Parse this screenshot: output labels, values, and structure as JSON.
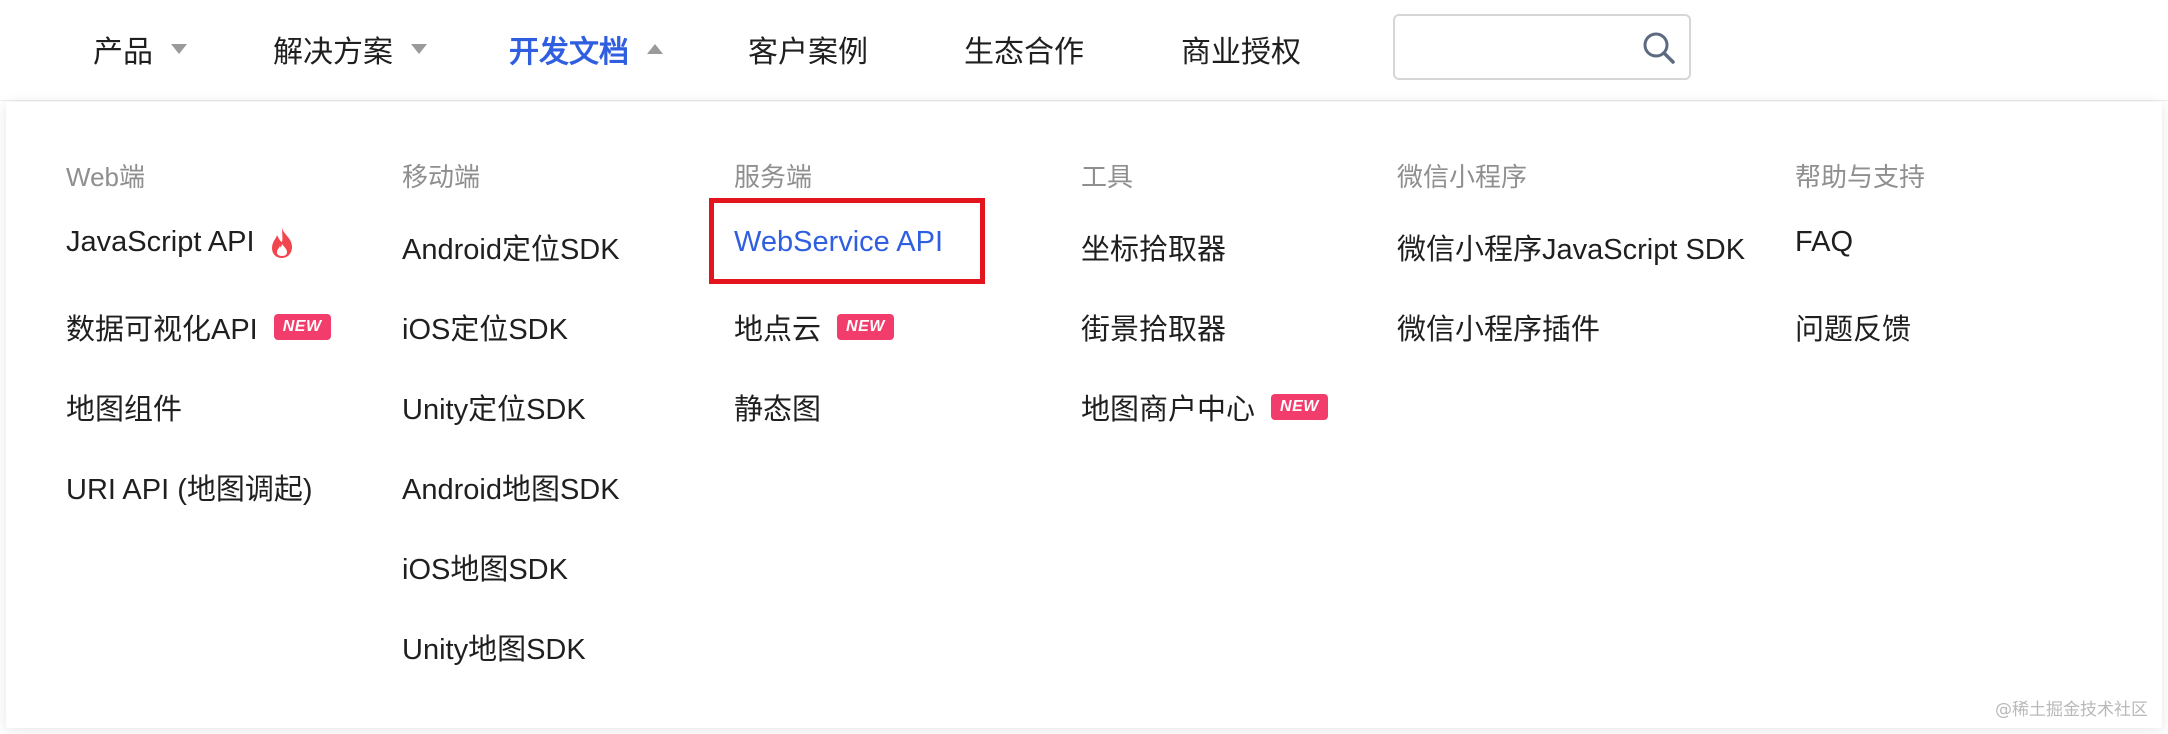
{
  "nav": {
    "items": [
      {
        "label": "产品"
      },
      {
        "label": "解决方案"
      },
      {
        "label": "开发文档"
      },
      {
        "label": "客户案例"
      },
      {
        "label": "生态合作"
      },
      {
        "label": "商业授权"
      }
    ],
    "search": {
      "placeholder": "",
      "value": ""
    }
  },
  "dropdown": {
    "badge_label": "NEW",
    "columns": [
      {
        "header": "Web端",
        "links": [
          {
            "label": "JavaScript API"
          },
          {
            "label": "数据可视化API"
          },
          {
            "label": "地图组件"
          },
          {
            "label": "URI API (地图调起)"
          }
        ]
      },
      {
        "header": "移动端",
        "links": [
          {
            "label": "Android定位SDK"
          },
          {
            "label": "iOS定位SDK"
          },
          {
            "label": "Unity定位SDK"
          },
          {
            "label": "Android地图SDK"
          },
          {
            "label": "iOS地图SDK"
          },
          {
            "label": "Unity地图SDK"
          }
        ]
      },
      {
        "header": "服务端",
        "links": [
          {
            "label": "WebService API"
          },
          {
            "label": "地点云"
          },
          {
            "label": "静态图"
          }
        ]
      },
      {
        "header": "工具",
        "links": [
          {
            "label": "坐标拾取器"
          },
          {
            "label": "街景拾取器"
          },
          {
            "label": "地图商户中心"
          }
        ]
      },
      {
        "header": "微信小程序",
        "links": [
          {
            "label": "微信小程序JavaScript SDK"
          },
          {
            "label": "微信小程序插件"
          }
        ]
      },
      {
        "header": "帮助与支持",
        "links": [
          {
            "label": "FAQ"
          },
          {
            "label": "问题反馈"
          }
        ]
      }
    ]
  },
  "watermark": "@稀土掘金技术社区",
  "colors": {
    "accent": "#2f5fe0",
    "badge": "#f23c6b",
    "highlight": "#e4141f",
    "header_text": "#8f8f8f"
  }
}
